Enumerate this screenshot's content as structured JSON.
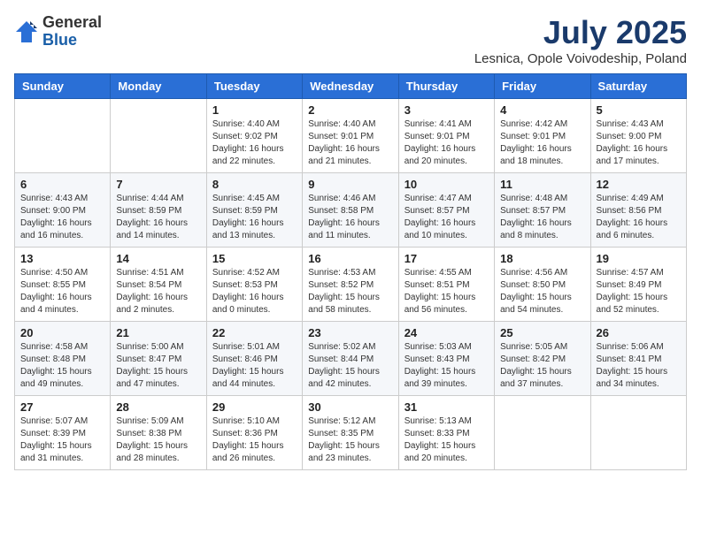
{
  "header": {
    "logo_general": "General",
    "logo_blue": "Blue",
    "month_title": "July 2025",
    "location": "Lesnica, Opole Voivodeship, Poland"
  },
  "days_of_week": [
    "Sunday",
    "Monday",
    "Tuesday",
    "Wednesday",
    "Thursday",
    "Friday",
    "Saturday"
  ],
  "weeks": [
    [
      {
        "day": "",
        "info": ""
      },
      {
        "day": "",
        "info": ""
      },
      {
        "day": "1",
        "info": "Sunrise: 4:40 AM\nSunset: 9:02 PM\nDaylight: 16 hours and 22 minutes."
      },
      {
        "day": "2",
        "info": "Sunrise: 4:40 AM\nSunset: 9:01 PM\nDaylight: 16 hours and 21 minutes."
      },
      {
        "day": "3",
        "info": "Sunrise: 4:41 AM\nSunset: 9:01 PM\nDaylight: 16 hours and 20 minutes."
      },
      {
        "day": "4",
        "info": "Sunrise: 4:42 AM\nSunset: 9:01 PM\nDaylight: 16 hours and 18 minutes."
      },
      {
        "day": "5",
        "info": "Sunrise: 4:43 AM\nSunset: 9:00 PM\nDaylight: 16 hours and 17 minutes."
      }
    ],
    [
      {
        "day": "6",
        "info": "Sunrise: 4:43 AM\nSunset: 9:00 PM\nDaylight: 16 hours and 16 minutes."
      },
      {
        "day": "7",
        "info": "Sunrise: 4:44 AM\nSunset: 8:59 PM\nDaylight: 16 hours and 14 minutes."
      },
      {
        "day": "8",
        "info": "Sunrise: 4:45 AM\nSunset: 8:59 PM\nDaylight: 16 hours and 13 minutes."
      },
      {
        "day": "9",
        "info": "Sunrise: 4:46 AM\nSunset: 8:58 PM\nDaylight: 16 hours and 11 minutes."
      },
      {
        "day": "10",
        "info": "Sunrise: 4:47 AM\nSunset: 8:57 PM\nDaylight: 16 hours and 10 minutes."
      },
      {
        "day": "11",
        "info": "Sunrise: 4:48 AM\nSunset: 8:57 PM\nDaylight: 16 hours and 8 minutes."
      },
      {
        "day": "12",
        "info": "Sunrise: 4:49 AM\nSunset: 8:56 PM\nDaylight: 16 hours and 6 minutes."
      }
    ],
    [
      {
        "day": "13",
        "info": "Sunrise: 4:50 AM\nSunset: 8:55 PM\nDaylight: 16 hours and 4 minutes."
      },
      {
        "day": "14",
        "info": "Sunrise: 4:51 AM\nSunset: 8:54 PM\nDaylight: 16 hours and 2 minutes."
      },
      {
        "day": "15",
        "info": "Sunrise: 4:52 AM\nSunset: 8:53 PM\nDaylight: 16 hours and 0 minutes."
      },
      {
        "day": "16",
        "info": "Sunrise: 4:53 AM\nSunset: 8:52 PM\nDaylight: 15 hours and 58 minutes."
      },
      {
        "day": "17",
        "info": "Sunrise: 4:55 AM\nSunset: 8:51 PM\nDaylight: 15 hours and 56 minutes."
      },
      {
        "day": "18",
        "info": "Sunrise: 4:56 AM\nSunset: 8:50 PM\nDaylight: 15 hours and 54 minutes."
      },
      {
        "day": "19",
        "info": "Sunrise: 4:57 AM\nSunset: 8:49 PM\nDaylight: 15 hours and 52 minutes."
      }
    ],
    [
      {
        "day": "20",
        "info": "Sunrise: 4:58 AM\nSunset: 8:48 PM\nDaylight: 15 hours and 49 minutes."
      },
      {
        "day": "21",
        "info": "Sunrise: 5:00 AM\nSunset: 8:47 PM\nDaylight: 15 hours and 47 minutes."
      },
      {
        "day": "22",
        "info": "Sunrise: 5:01 AM\nSunset: 8:46 PM\nDaylight: 15 hours and 44 minutes."
      },
      {
        "day": "23",
        "info": "Sunrise: 5:02 AM\nSunset: 8:44 PM\nDaylight: 15 hours and 42 minutes."
      },
      {
        "day": "24",
        "info": "Sunrise: 5:03 AM\nSunset: 8:43 PM\nDaylight: 15 hours and 39 minutes."
      },
      {
        "day": "25",
        "info": "Sunrise: 5:05 AM\nSunset: 8:42 PM\nDaylight: 15 hours and 37 minutes."
      },
      {
        "day": "26",
        "info": "Sunrise: 5:06 AM\nSunset: 8:41 PM\nDaylight: 15 hours and 34 minutes."
      }
    ],
    [
      {
        "day": "27",
        "info": "Sunrise: 5:07 AM\nSunset: 8:39 PM\nDaylight: 15 hours and 31 minutes."
      },
      {
        "day": "28",
        "info": "Sunrise: 5:09 AM\nSunset: 8:38 PM\nDaylight: 15 hours and 28 minutes."
      },
      {
        "day": "29",
        "info": "Sunrise: 5:10 AM\nSunset: 8:36 PM\nDaylight: 15 hours and 26 minutes."
      },
      {
        "day": "30",
        "info": "Sunrise: 5:12 AM\nSunset: 8:35 PM\nDaylight: 15 hours and 23 minutes."
      },
      {
        "day": "31",
        "info": "Sunrise: 5:13 AM\nSunset: 8:33 PM\nDaylight: 15 hours and 20 minutes."
      },
      {
        "day": "",
        "info": ""
      },
      {
        "day": "",
        "info": ""
      }
    ]
  ]
}
